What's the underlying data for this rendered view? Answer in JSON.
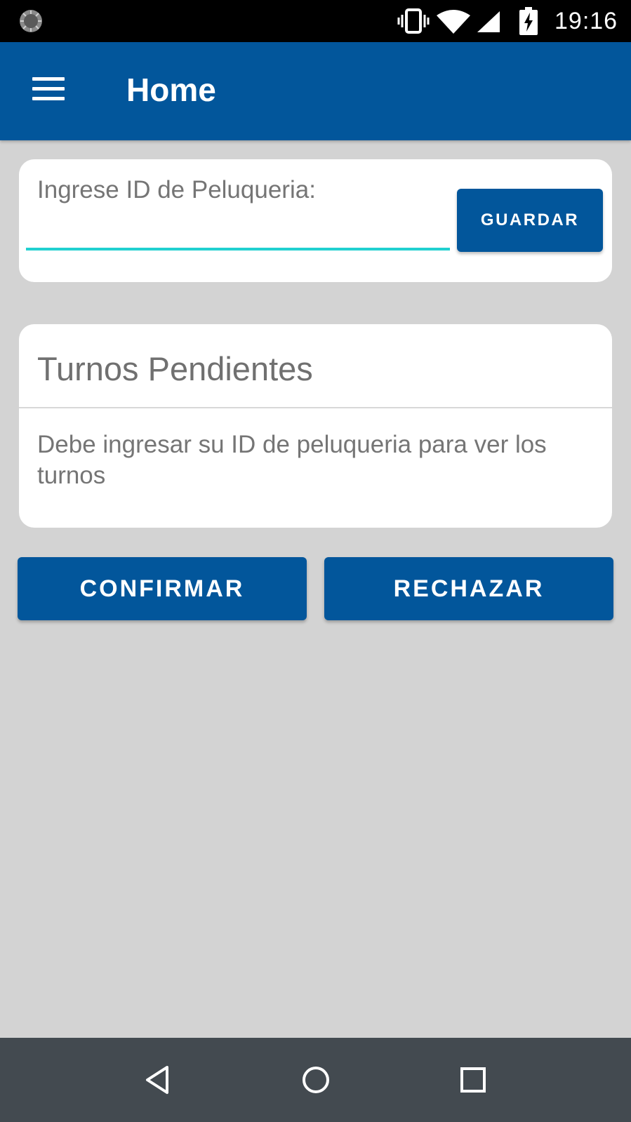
{
  "status_bar": {
    "time": "19:16",
    "icons": [
      "loading-spinner-icon",
      "vibrate-icon",
      "wifi-icon",
      "signal-icon",
      "battery-charging-icon"
    ]
  },
  "app_bar": {
    "title": "Home",
    "menu_icon": "hamburger-menu-icon",
    "color": "#02569b"
  },
  "id_card": {
    "label": "Ingrese ID de Peluqueria:",
    "input_value": "",
    "save_label": "GUARDAR",
    "underline_color": "#21d0d0"
  },
  "turnos_card": {
    "title": "Turnos Pendientes",
    "message": "Debe ingresar su ID de peluqueria para ver los turnos"
  },
  "actions": {
    "confirm_label": "CONFIRMAR",
    "reject_label": "RECHAZAR"
  },
  "nav_bar": {
    "icons": [
      "back-icon",
      "home-icon",
      "recents-icon"
    ]
  }
}
